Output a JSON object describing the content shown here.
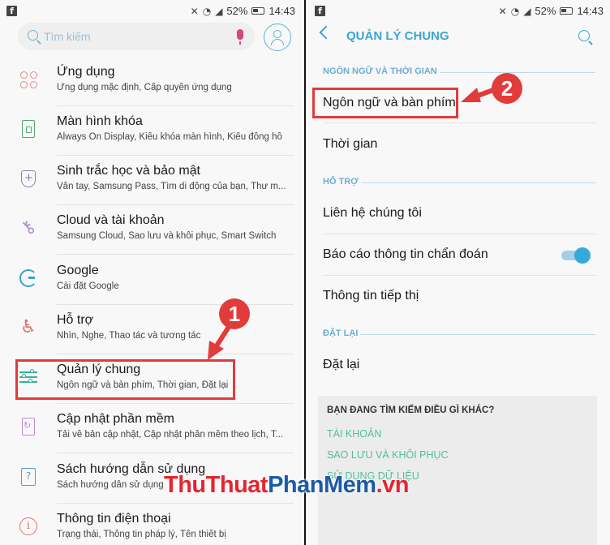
{
  "colors": {
    "accent": "#3aa6d6",
    "annotation_red": "#e23b3b",
    "link_green": "#4fbf9e",
    "watermark_red": "#e3262e",
    "watermark_blue": "#1b5aa8"
  },
  "status_bar": {
    "app_icon": "f",
    "battery_percent": "52%",
    "time": "14:43",
    "icons": [
      "mute-icon",
      "wifi-icon",
      "signal-icon",
      "battery-icon"
    ]
  },
  "left": {
    "search": {
      "placeholder": "Tìm kiếm",
      "icon": "search-icon",
      "mic_icon": "microphone-icon"
    },
    "account_icon": "account-icon",
    "items": [
      {
        "id": "apps",
        "icon": "apps-icon",
        "title": "Ứng dụng",
        "subtitle": "Ứng dụng mặc định, Cấp quyền ứng dụng"
      },
      {
        "id": "lock-screen",
        "icon": "lock-screen-icon",
        "title": "Màn hình khóa",
        "subtitle": "Always On Display, Kiểu khóa màn hình, Kiểu đồng hồ"
      },
      {
        "id": "biometrics",
        "icon": "shield-icon",
        "title": "Sinh trắc học và bảo mật",
        "subtitle": "Vân tay, Samsung Pass, Tìm di động của bạn, Thư m..."
      },
      {
        "id": "cloud",
        "icon": "key-icon",
        "title": "Cloud và tài khoản",
        "subtitle": "Samsung Cloud, Sao lưu và khôi phục, Smart Switch"
      },
      {
        "id": "google",
        "icon": "google-icon",
        "title": "Google",
        "subtitle": "Cài đặt Google"
      },
      {
        "id": "accessibility",
        "icon": "accessibility-icon",
        "title": "Hỗ trợ",
        "subtitle": "Nhìn, Nghe, Thao tác và tương tác"
      },
      {
        "id": "general-management",
        "icon": "sliders-icon",
        "title": "Quản lý chung",
        "subtitle": "Ngôn ngữ và bàn phím, Thời gian, Đặt lại"
      },
      {
        "id": "software-update",
        "icon": "update-icon",
        "title": "Cập nhật phần mềm",
        "subtitle": "Tải về bản cập nhật, Cập nhật phần mềm theo lịch, T..."
      },
      {
        "id": "user-manual",
        "icon": "manual-icon",
        "title": "Sách hướng dẫn sử dụng",
        "subtitle": "Sách hướng dẫn sử dụng"
      },
      {
        "id": "about-phone",
        "icon": "info-icon",
        "title": "Thông tin điện thoại",
        "subtitle": "Trạng thái, Thông tin pháp lý, Tên thiết bị"
      }
    ],
    "step_badge": "1"
  },
  "right": {
    "title": "QUẢN LÝ CHUNG",
    "sections": [
      {
        "header": "NGÔN NGỮ VÀ THỜI GIAN",
        "items": [
          {
            "label": "Ngôn ngữ và bàn phím"
          },
          {
            "label": "Thời gian"
          }
        ]
      },
      {
        "header": "HỖ TRỢ",
        "items": [
          {
            "label": "Liên hệ chúng tôi"
          },
          {
            "label": "Báo cáo thông tin chẩn đoán",
            "toggle": true
          },
          {
            "label": "Thông tin tiếp thị"
          }
        ]
      },
      {
        "header": "ĐẶT LẠI",
        "items": [
          {
            "label": "Đặt lại"
          }
        ]
      }
    ],
    "suggestions": {
      "title": "BẠN ĐANG TÌM KIẾM ĐIỀU GÌ KHÁC?",
      "links": [
        "TÀI KHOẢN",
        "SAO LƯU VÀ KHÔI PHỤC",
        "SỬ DỤNG DỮ LIỆU"
      ]
    },
    "step_badge": "2"
  },
  "watermark": {
    "part1": "ThuThuat",
    "part2": "PhanMem",
    "part3": ".vn"
  }
}
